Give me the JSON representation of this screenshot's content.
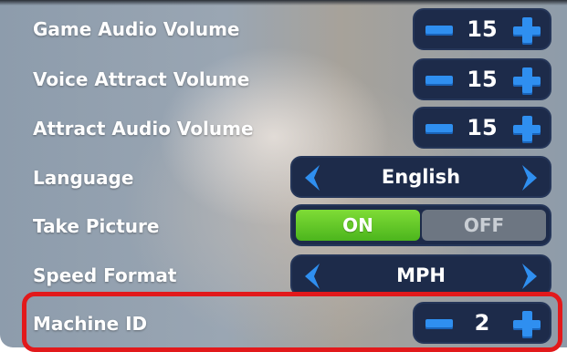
{
  "settings": {
    "game_audio_volume": {
      "label": "Game Audio Volume",
      "value": "15"
    },
    "voice_attract_volume": {
      "label": "Voice Attract Volume",
      "value": "15"
    },
    "attract_audio_volume": {
      "label": "Attract Audio Volume",
      "value": "15"
    },
    "language": {
      "label": "Language",
      "value": "English"
    },
    "take_picture": {
      "label": "Take Picture",
      "on_label": "ON",
      "off_label": "OFF",
      "selected": "ON"
    },
    "speed_format": {
      "label": "Speed Format",
      "value": "MPH"
    },
    "machine_id": {
      "label": "Machine ID",
      "value": "2"
    }
  },
  "icons": {
    "decrement": "minus-icon",
    "increment": "plus-icon",
    "previous": "chevron-left-icon",
    "next": "chevron-right-icon"
  },
  "colors": {
    "control_background": "#1d2b4a",
    "accent_blue": "#2f8ff0",
    "toggle_on": "#4cb51d",
    "toggle_off": "#6d7682",
    "annotation_red": "#e2191b"
  }
}
